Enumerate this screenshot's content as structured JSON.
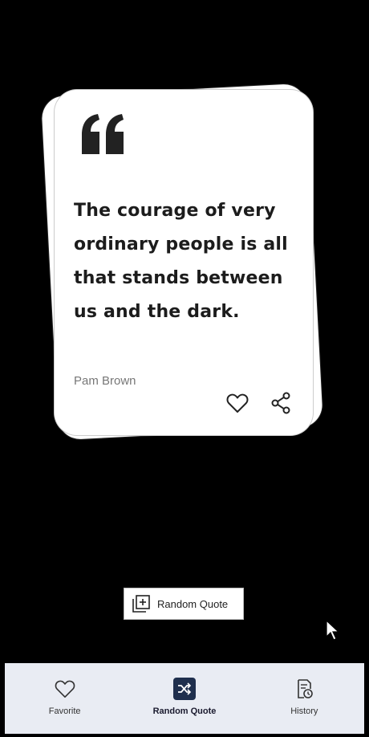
{
  "quote": {
    "text": "The courage of very ordinary people is all that stands between us and the dark.",
    "author": "Pam Brown"
  },
  "icons": {
    "quote_mark": "quote-mark-icon",
    "like": "heart-icon",
    "share": "share-icon",
    "random": "add-box-icon",
    "nav_favorite": "heart-icon",
    "nav_random": "shuffle-icon",
    "nav_history": "history-icon"
  },
  "actions": {
    "random_label": "Random Quote"
  },
  "nav": {
    "items": [
      {
        "label": "Favorite",
        "active": false
      },
      {
        "label": "Random Quote",
        "active": true
      },
      {
        "label": "History",
        "active": false
      }
    ]
  },
  "colors": {
    "background": "#000000",
    "card": "#ffffff",
    "nav_background": "#e9ecf3",
    "nav_active": "#1f2f4d"
  }
}
